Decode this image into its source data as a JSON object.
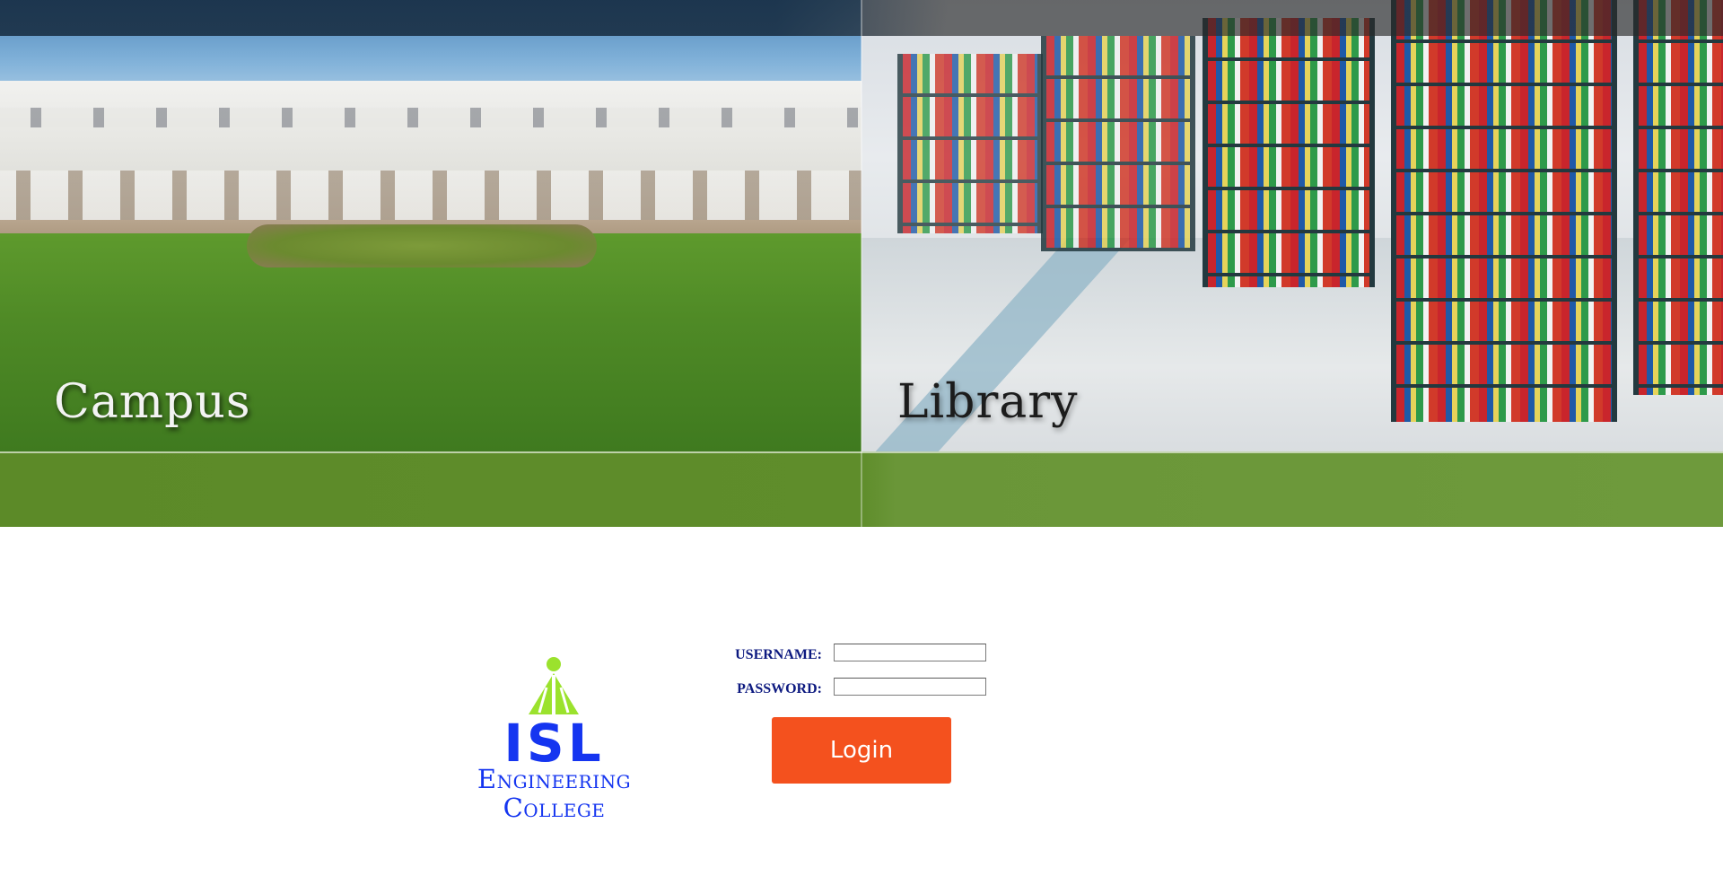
{
  "banner": {
    "left_label": "Campus",
    "right_label": "Library"
  },
  "logo": {
    "name": "ISL",
    "line1": "Engineering",
    "line2": "College",
    "colors": {
      "text": "#1535f0",
      "emblem": "#9be22d"
    }
  },
  "login": {
    "username_label": "USERNAME:",
    "username_value": "",
    "password_label": "PASSWORD:",
    "password_value": "",
    "button_label": "Login",
    "button_color": "#f4511e",
    "label_color": "#0d1a80"
  }
}
